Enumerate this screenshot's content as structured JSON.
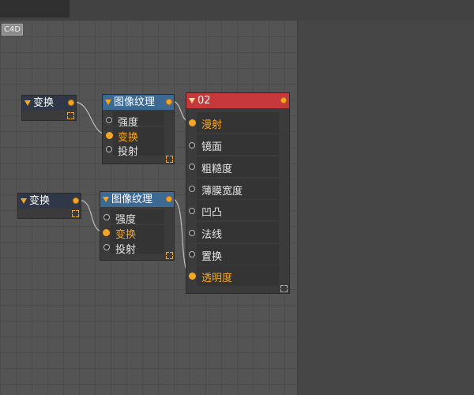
{
  "badge": {
    "label": "C4D"
  },
  "nodes": {
    "transform1": {
      "title": "变换"
    },
    "transform2": {
      "title": "变换"
    },
    "texture1": {
      "title": "图像纹理",
      "ports": [
        "强度",
        "变换",
        "投射"
      ]
    },
    "texture2": {
      "title": "图像纹理",
      "ports": [
        "强度",
        "变换",
        "投射"
      ]
    },
    "material": {
      "title": "02",
      "ports": [
        "漫射",
        "镜面",
        "粗糙度",
        "薄膜宽度",
        "凹凸",
        "法线",
        "置换",
        "透明度"
      ]
    }
  },
  "colors": {
    "accent": "#f5a623",
    "material_header": "#c7383a",
    "texture_header": "#3d6a94",
    "transform_header": "#2f3748"
  },
  "icons": {
    "collapse": "triangle-down-icon",
    "expand": "expand-icon"
  }
}
